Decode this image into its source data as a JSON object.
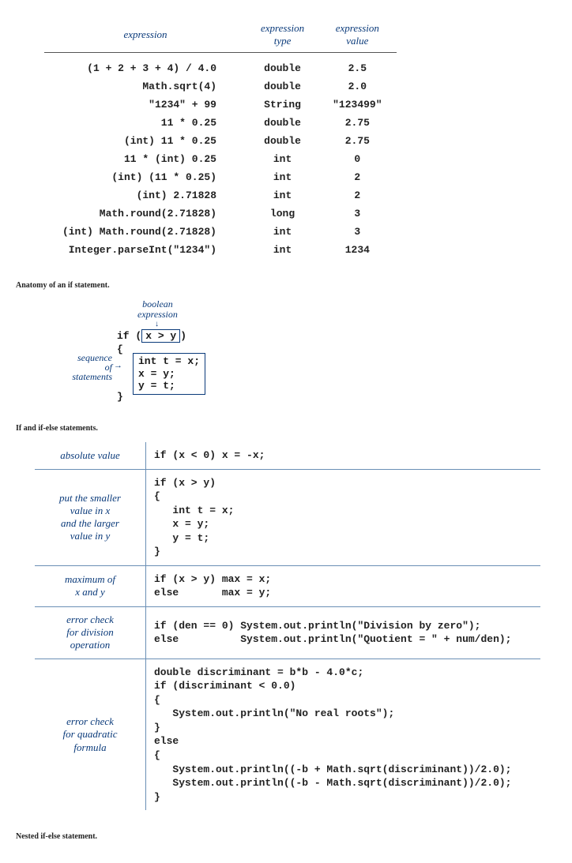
{
  "expr_table": {
    "headers": {
      "c0": "expression",
      "c1": "expression\ntype",
      "c2": "expression\nvalue"
    },
    "rows": [
      {
        "expr": "(1 + 2 + 3 + 4) / 4.0",
        "type": "double",
        "val": "2.5"
      },
      {
        "expr": "Math.sqrt(4)",
        "type": "double",
        "val": "2.0"
      },
      {
        "expr": "\"1234\" + 99",
        "type": "String",
        "val": "\"123499\""
      },
      {
        "expr": "11 * 0.25",
        "type": "double",
        "val": "2.75"
      },
      {
        "expr": "(int) 11 * 0.25",
        "type": "double",
        "val": "2.75"
      },
      {
        "expr": "11 * (int) 0.25",
        "type": "int",
        "val": "0"
      },
      {
        "expr": "(int) (11 * 0.25)",
        "type": "int",
        "val": "2"
      },
      {
        "expr": "(int) 2.71828",
        "type": "int",
        "val": "2"
      },
      {
        "expr": "Math.round(2.71828)",
        "type": "long",
        "val": "3"
      },
      {
        "expr": "(int) Math.round(2.71828)",
        "type": "int",
        "val": "3"
      },
      {
        "expr": "Integer.parseInt(\"1234\")",
        "type": "int",
        "val": "1234"
      }
    ]
  },
  "headings": {
    "anatomy": "Anatomy of an if statement.",
    "ifelse": "If and if-else statements.",
    "nested": "Nested if-else statement."
  },
  "anatomy": {
    "boolexp_label": "boolean\nexpression",
    "seq_label": "sequence\nof\nstatements",
    "if_kw": "if (",
    "cond": "x > y",
    "close_paren": ")",
    "brace_open": "{",
    "brace_close": "}",
    "stmt1": "int t = x;",
    "stmt2": "x = y;",
    "stmt3": "y = t;"
  },
  "examples": [
    {
      "label": "absolute value",
      "code": "if (x < 0) x = -x;"
    },
    {
      "label": "put the smaller\nvalue in x\nand the larger\nvalue in y",
      "code": "if (x > y)\n{\n   int t = x;\n   x = y;\n   y = t;\n}"
    },
    {
      "label": "maximum of\nx and y",
      "code": "if (x > y) max = x;\nelse       max = y;"
    },
    {
      "label": "error check\nfor division\noperation",
      "code": "if (den == 0) System.out.println(\"Division by zero\");\nelse          System.out.println(\"Quotient = \" + num/den);"
    },
    {
      "label": "error check\nfor quadratic\nformula",
      "code": "double discriminant = b*b - 4.0*c;\nif (discriminant < 0.0)\n{\n   System.out.println(\"No real roots\");\n}\nelse\n{\n   System.out.println((-b + Math.sqrt(discriminant))/2.0);\n   System.out.println((-b - Math.sqrt(discriminant))/2.0);\n}"
    }
  ]
}
